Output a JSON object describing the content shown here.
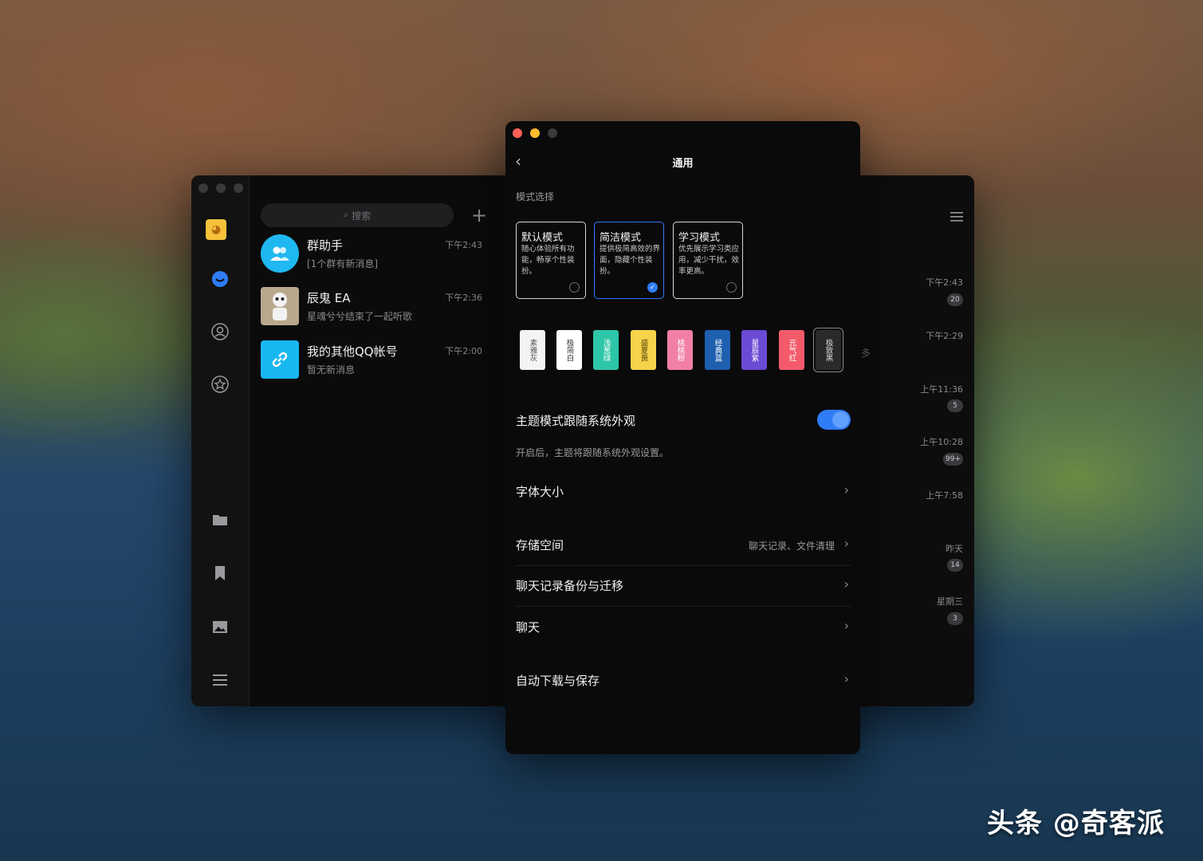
{
  "main_window": {
    "search_placeholder": "搜索",
    "conversations": [
      {
        "name": "群助手",
        "message": "[1个群有新消息]",
        "time": "下午2:43",
        "avatar_color": "#1fb8f0"
      },
      {
        "name": "辰鬼 EA",
        "message": "星魂兮兮结束了一起听歌",
        "time": "下午2:36",
        "avatar_color": "#b9a88c"
      },
      {
        "name": "我的其他QQ帐号",
        "message": "暂无新消息",
        "time": "下午2:00",
        "avatar_color": "#19b7f2"
      }
    ],
    "right_times": [
      {
        "time": "下午2:43",
        "badge": "20"
      },
      {
        "time": "下午2:29",
        "badge": ""
      },
      {
        "time": "上午11:36",
        "badge": "5"
      },
      {
        "time": "上午10:28",
        "badge": "99+"
      },
      {
        "time": "上午7:58",
        "badge": ""
      },
      {
        "time": "昨天",
        "badge": "14"
      },
      {
        "time": "星期三",
        "badge": "3"
      }
    ],
    "partial_text": "多"
  },
  "settings": {
    "title": "通用",
    "section_mode": "模式选择",
    "modes": [
      {
        "title": "默认模式",
        "desc": "随心体验所有功能，畅享个性装扮。",
        "selected": false
      },
      {
        "title": "简洁模式",
        "desc": "提供极简高效的界面，隐藏个性装扮。",
        "selected": true
      },
      {
        "title": "学习模式",
        "desc": "优先展示学习类应用，减少干扰，效率更高。",
        "selected": false
      }
    ],
    "swatches": [
      {
        "label": "素雅灰",
        "bg": "#f4f4f4",
        "fg": "#555555"
      },
      {
        "label": "极简白",
        "bg": "#ffffff",
        "fg": "#333333"
      },
      {
        "label": "浅葱绿",
        "bg": "#2ec6a8",
        "fg": "#ffffff"
      },
      {
        "label": "盛夏黄",
        "bg": "#f6d44a",
        "fg": "#5a4a10"
      },
      {
        "label": "桃桃粉",
        "bg": "#f27fa6",
        "fg": "#ffffff"
      },
      {
        "label": "经典蓝",
        "bg": "#1e5fae",
        "fg": "#ffffff"
      },
      {
        "label": "星辰紫",
        "bg": "#6b4ad6",
        "fg": "#ffffff"
      },
      {
        "label": "元气红",
        "bg": "#f35b6b",
        "fg": "#ffffff"
      },
      {
        "label": "极致黑",
        "bg": "#2a2a2c",
        "fg": "#dddddd"
      }
    ],
    "follow_system_label": "主题模式跟随系统外观",
    "follow_system_on": true,
    "follow_system_hint": "开启后，主题将跟随系统外观设置。",
    "font_size_label": "字体大小",
    "storage_label": "存储空间",
    "storage_value": "聊天记录、文件清理",
    "backup_label": "聊天记录备份与迁移",
    "chat_label": "聊天",
    "auto_download_label": "自动下载与保存",
    "accent": "#2f7cf6"
  },
  "watermark": "头条 @奇客派"
}
